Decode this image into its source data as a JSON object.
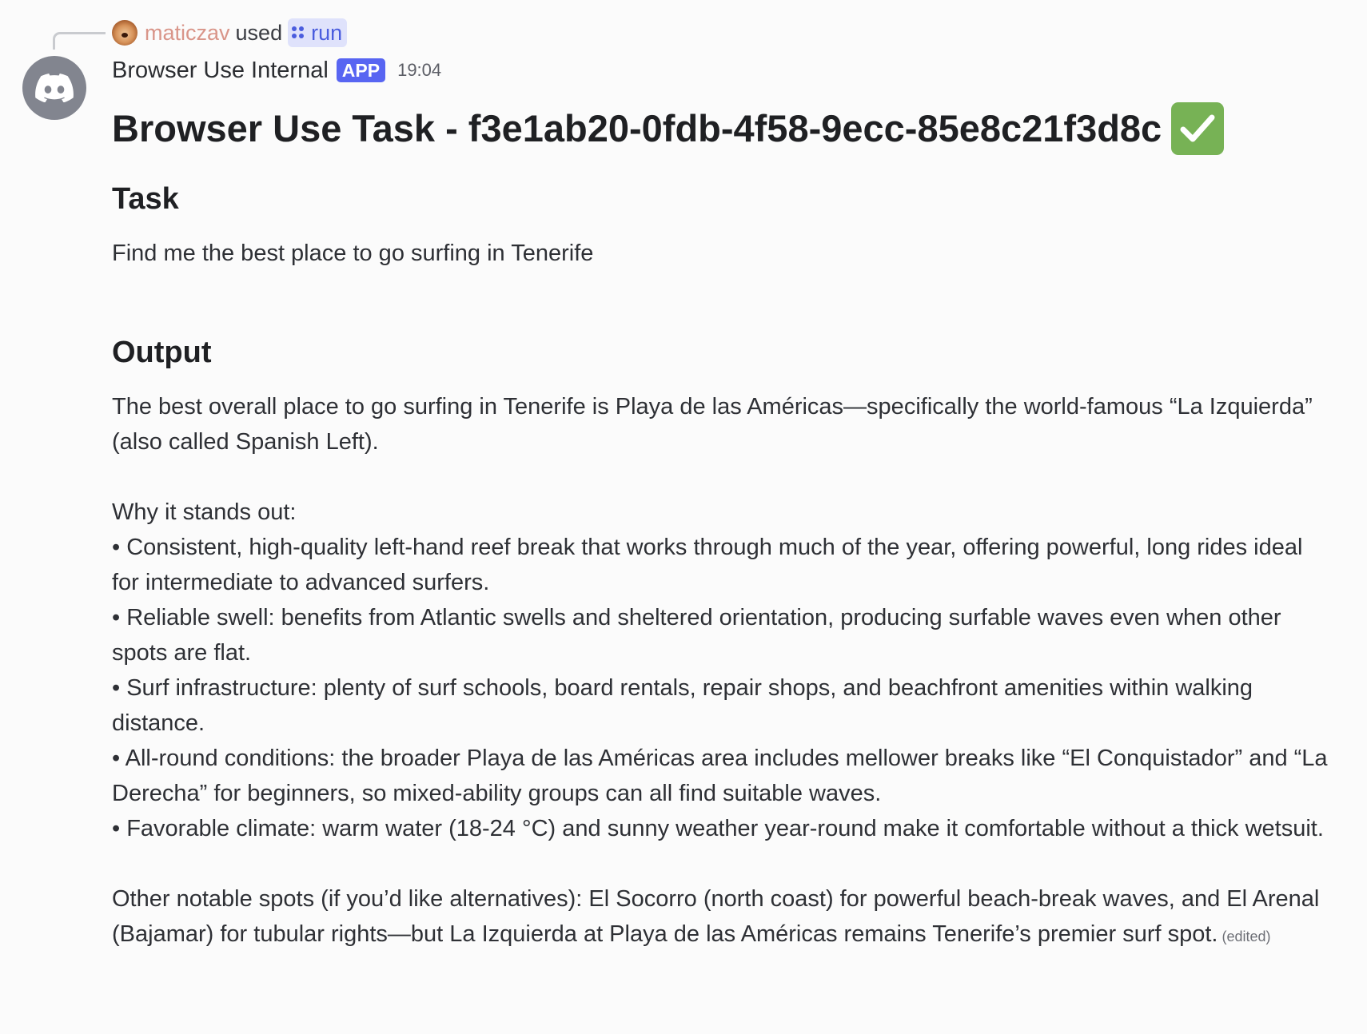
{
  "reply": {
    "username": "maticzav",
    "used_text": "used",
    "command": "run",
    "user_color": "#d99589",
    "command_color": "#4b5dde"
  },
  "message": {
    "author": "Browser Use Internal",
    "badge": "APP",
    "badge_color": "#5865f2",
    "timestamp": "19:04",
    "avatar_icon": "discord-logo-icon",
    "title": "Browser Use Task - f3e1ab20-0fdb-4f58-9ecc-85e8c21f3d8c",
    "title_emoji": "white-check-mark-icon",
    "task_heading": "Task",
    "task_text": "Find me the best place to go surfing in Tenerife",
    "output_heading": "Output",
    "output_intro": "The best overall place to go surfing in Tenerife is Playa de las Américas—specifically the world-famous “La Izquierda” (also called Spanish Left).",
    "why_heading": "Why it stands out:",
    "bullets": [
      "• Consistent, high-quality left-hand reef break that works through much of the year, offering powerful, long rides ideal for intermediate to advanced surfers.",
      "• Reliable swell: benefits from Atlantic swells and sheltered orientation, producing surfable waves even when other spots are flat.",
      "• Surf infrastructure: plenty of surf schools, board rentals, repair shops, and beachfront amenities within walking distance.",
      "• All-round conditions: the broader Playa de las Américas area includes mellower breaks like “El Conquistador” and “La Derecha” for beginners, so mixed-ability groups can all find suitable waves.",
      "• Favorable climate: warm water (18-24 °C) and sunny weather year-round make it comfortable without a thick wetsuit."
    ],
    "other_spots": "Other notable spots (if you’d like alternatives): El Socorro (north coast) for powerful beach-break waves, and El Arenal (Bajamar) for tubular rights—but La Izquierda at Playa de las Américas remains Tenerife’s premier surf spot.",
    "edited_label": "(edited)"
  }
}
